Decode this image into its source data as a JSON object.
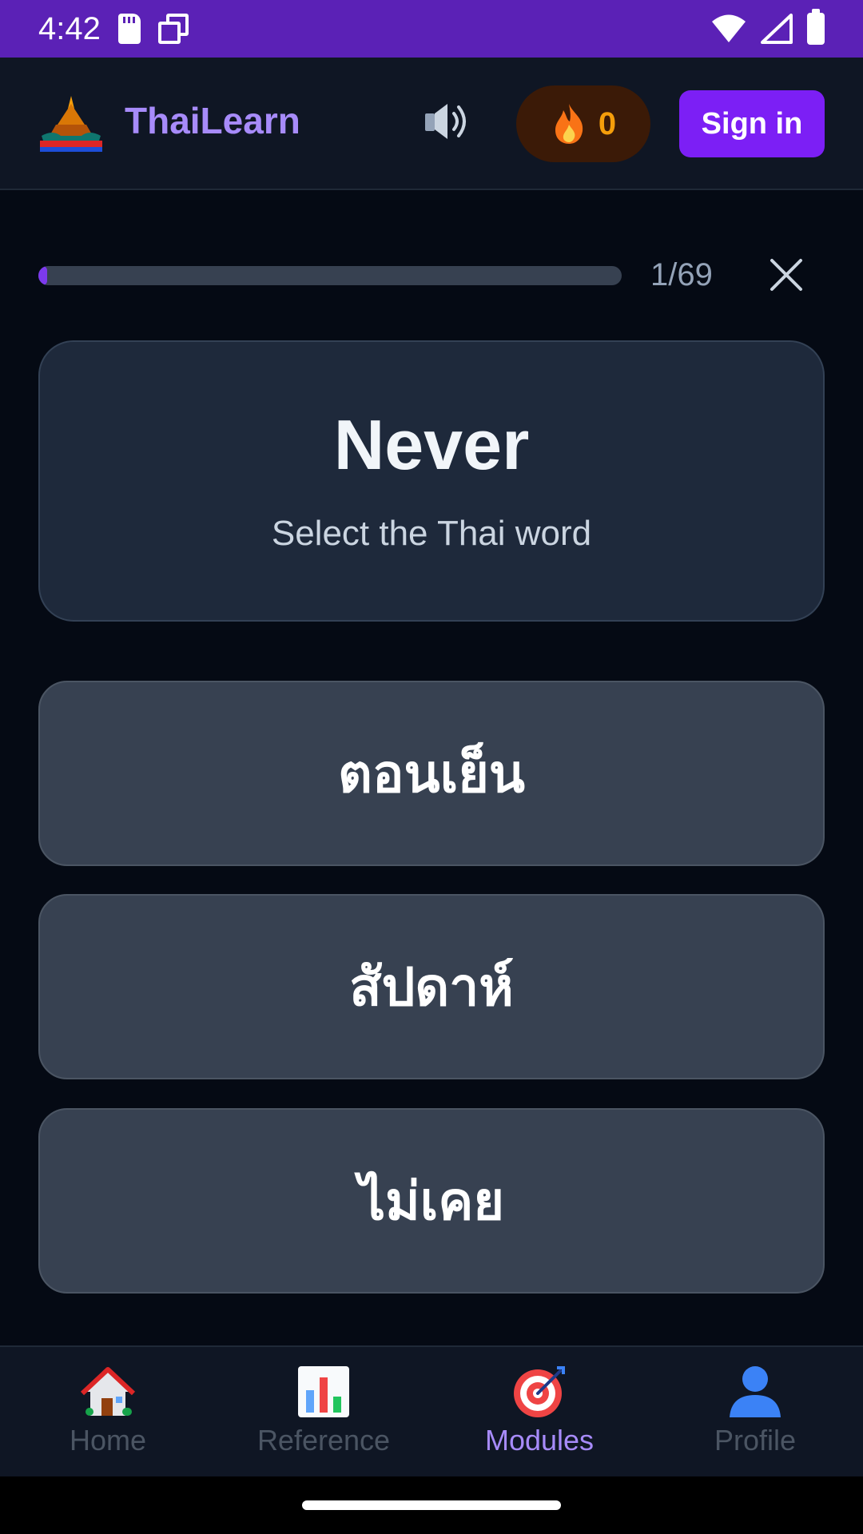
{
  "status_bar": {
    "time": "4:42",
    "icons": [
      "sd-card-icon",
      "screen-copy-icon",
      "wifi-icon",
      "signal-icon",
      "battery-icon"
    ]
  },
  "header": {
    "app_name": "ThaiLearn",
    "logo_icon": "thai-temple-logo",
    "sound_icon": "speaker-icon",
    "streak_icon": "flame-icon",
    "streak_count": "0",
    "sign_in_label": "Sign in",
    "accent_color": "#a78bfa",
    "button_color": "#7c1ff5"
  },
  "progress": {
    "current": 1,
    "total": 69,
    "label": "1/69",
    "close_icon": "close-icon"
  },
  "prompt": {
    "word": "Never",
    "instruction": "Select the Thai word"
  },
  "options": [
    {
      "text": "ตอนเย็น"
    },
    {
      "text": "สัปดาห์"
    },
    {
      "text": "ไม่เคย"
    }
  ],
  "bottom_nav": {
    "items": [
      {
        "label": "Home",
        "icon": "house-icon",
        "active": false
      },
      {
        "label": "Reference",
        "icon": "bar-chart-icon",
        "active": false
      },
      {
        "label": "Modules",
        "icon": "target-icon",
        "active": true
      },
      {
        "label": "Profile",
        "icon": "person-icon",
        "active": false
      }
    ]
  }
}
